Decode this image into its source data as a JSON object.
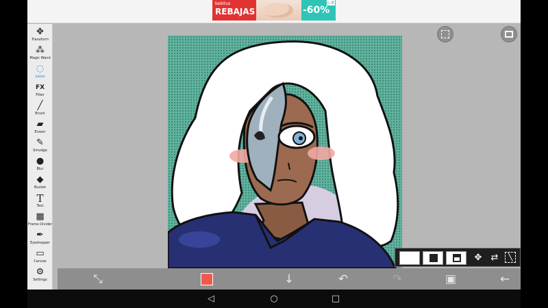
{
  "ad": {
    "brand": "bebitus",
    "headline": "REBAJAS",
    "discount": "-60%",
    "close_label": "▷X"
  },
  "toolbar": {
    "items": [
      {
        "label": "Transform",
        "icon": "✥"
      },
      {
        "label": "Magic Wand",
        "icon": "⁂"
      },
      {
        "label": "Lasso",
        "icon": "◌"
      },
      {
        "label": "Filter",
        "icon": "FX"
      },
      {
        "label": "Brush",
        "icon": "╱"
      },
      {
        "label": "Eraser",
        "icon": "▰"
      },
      {
        "label": "Smudge",
        "icon": "✎"
      },
      {
        "label": "Blur",
        "icon": "●"
      },
      {
        "label": "Bucket",
        "icon": "◆"
      },
      {
        "label": "Text",
        "icon": "T"
      },
      {
        "label": "Frame Divider",
        "icon": "▦"
      },
      {
        "label": "Eyedropper",
        "icon": "✒"
      },
      {
        "label": "Canvas",
        "icon": "▭"
      },
      {
        "label": "Settings",
        "icon": "⚙"
      }
    ],
    "active_index": 2
  },
  "colors": {
    "primary": "#f05a4c",
    "active_tool": "#2a7fd8",
    "canvas_bg": "#5fb39f"
  },
  "bottom_bar": {
    "icons": [
      "transform-icon",
      "color-swatch",
      "arrow-down-icon",
      "undo-icon",
      "redo-icon",
      "layers-icon",
      "back-arrow-icon"
    ]
  }
}
